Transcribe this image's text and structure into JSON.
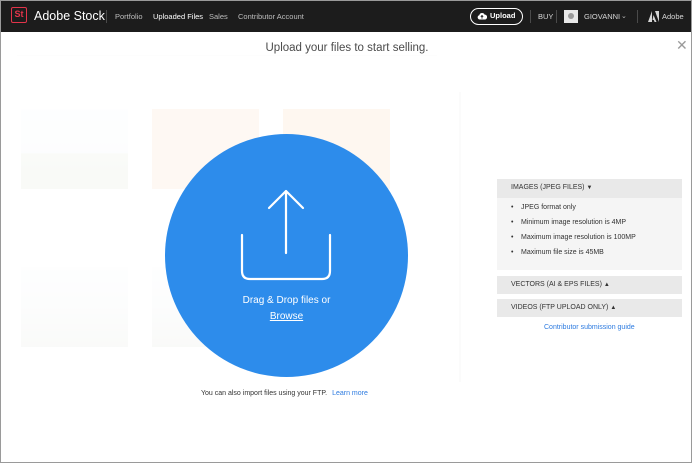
{
  "topbar": {
    "logo_letters": "St",
    "app_title": "Adobe Stock",
    "nav": [
      "Portfolio",
      "Uploaded Files",
      "Sales",
      "Contributor Account"
    ],
    "upload_label": "Upload",
    "buy_label": "BUY",
    "user_name": "GIOVANNI",
    "adobe_label": "Adobe"
  },
  "modal": {
    "title": "Upload your files to start selling.",
    "drop_text": "Drag & Drop files or",
    "browse_label": "Browse",
    "ftp_text": "You can also import files using your FTP.",
    "learn_more": "Learn more",
    "accent": "#2d8ceb"
  },
  "info": {
    "images_head": "IMAGES (JPEG FILES)",
    "images_items": [
      "JPEG format only",
      "Minimum image resolution is 4MP",
      "Maximum image resolution is 100MP",
      "Maximum file size is 45MB"
    ],
    "vectors_head": "VECTORS (AI & EPS FILES)",
    "videos_head": "VIDEOS (FTP UPLOAD ONLY)",
    "guide_link": "Contributor submission guide"
  }
}
